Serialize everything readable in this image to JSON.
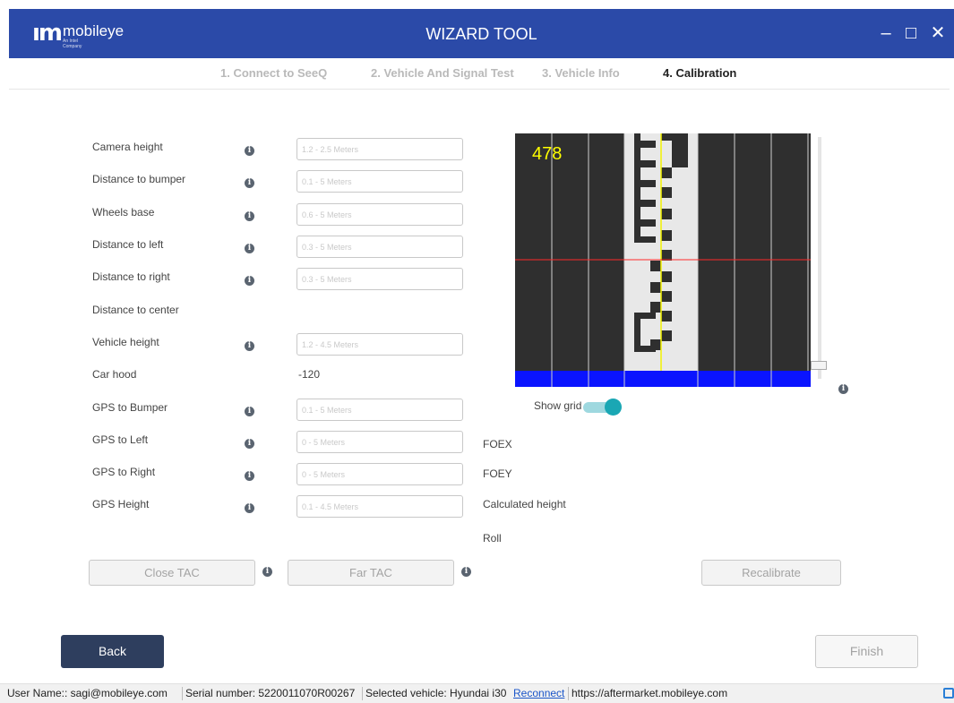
{
  "app": {
    "logo_text": "mobileye",
    "logo_subtext": "An Intel Company",
    "title": "WIZARD TOOL",
    "window_controls": [
      "minimize-icon",
      "maximize-icon",
      "close-icon"
    ]
  },
  "steps": [
    {
      "label": "1. Connect to SeeQ",
      "active": false
    },
    {
      "label": "2. Vehicle And Signal Test",
      "active": false
    },
    {
      "label": "3. Vehicle Info",
      "active": false
    },
    {
      "label": "4. Calibration",
      "active": true
    }
  ],
  "form": {
    "camera_height": {
      "label": "Camera height",
      "placeholder": "1.2 - 2.5 Meters",
      "value": ""
    },
    "distance_to_bumper": {
      "label": "Distance to bumper",
      "placeholder": "0.1 - 5 Meters",
      "value": ""
    },
    "wheels_base": {
      "label": "Wheels base",
      "placeholder": "0.6 - 5 Meters",
      "value": ""
    },
    "distance_to_left": {
      "label": "Distance to left",
      "placeholder": "0.3 - 5 Meters",
      "value": ""
    },
    "distance_to_right": {
      "label": "Distance to right",
      "placeholder": "0.3 - 5 Meters",
      "value": ""
    },
    "distance_to_center": {
      "label": "Distance to center"
    },
    "vehicle_height": {
      "label": "Vehicle height",
      "placeholder": "1.2 - 4.5 Meters",
      "value": ""
    },
    "car_hood": {
      "label": "Car hood",
      "value": "-120"
    },
    "gps_to_bumper": {
      "label": "GPS to Bumper",
      "placeholder": "0.1 - 5 Meters",
      "value": ""
    },
    "gps_to_left": {
      "label": "GPS to Left",
      "placeholder": "0 - 5 Meters",
      "value": ""
    },
    "gps_to_right": {
      "label": "GPS to Right",
      "placeholder": "0 - 5 Meters",
      "value": ""
    },
    "gps_height": {
      "label": "GPS Height",
      "placeholder": "0.1 - 4.5 Meters",
      "value": ""
    }
  },
  "camera": {
    "value": "478",
    "show_grid_label": "Show grid",
    "show_grid_on": true,
    "colors": {
      "horizon_line": "#ff2a2a",
      "center_line": "#f3f300",
      "bottom_bar": "#0a14ff",
      "value_text": "#ffff00"
    }
  },
  "results": {
    "foex": "FOEX",
    "foey": "FOEY",
    "calculated_height": "Calculated height",
    "roll": "Roll"
  },
  "buttons": {
    "close_tac": "Close TAC",
    "far_tac": "Far TAC",
    "recalibrate": "Recalibrate",
    "back": "Back",
    "finish": "Finish"
  },
  "statusbar": {
    "user": "User Name:: sagi@mobileye.com",
    "serial": "Serial number:  5220011070R00267",
    "vehicle": "Selected vehicle:  Hyundai i30",
    "reconnect": "Reconnect",
    "url": "https://aftermarket.mobileye.com"
  },
  "colors": {
    "titlebar": "#2b4aa8",
    "back_button": "#2e3e5e",
    "toggle": "#1aa7b4"
  }
}
